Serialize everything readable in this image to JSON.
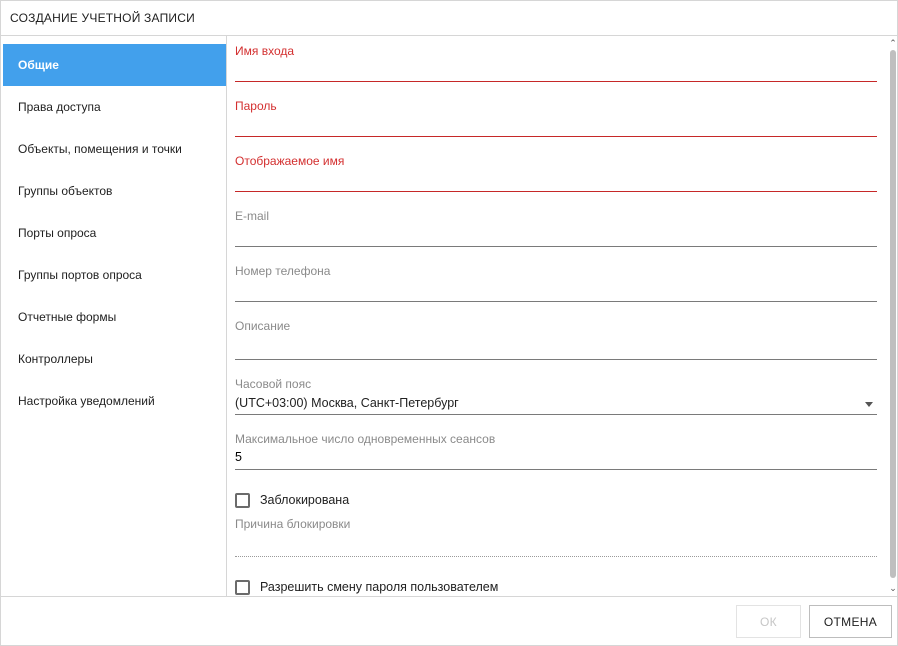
{
  "dialog": {
    "title": "СОЗДАНИЕ УЧЕТНОЙ ЗАПИСИ"
  },
  "sidebar": {
    "active_index": 0,
    "items": [
      {
        "label": "Общие"
      },
      {
        "label": "Права доступа"
      },
      {
        "label": "Объекты, помещения и точки"
      },
      {
        "label": "Группы объектов"
      },
      {
        "label": "Порты опроса"
      },
      {
        "label": "Группы портов опроса"
      },
      {
        "label": "Отчетные формы"
      },
      {
        "label": "Контроллеры"
      },
      {
        "label": "Настройка уведомлений"
      }
    ]
  },
  "form": {
    "login": {
      "label": "Имя входа",
      "value": "",
      "required": true
    },
    "password": {
      "label": "Пароль",
      "value": "",
      "required": true
    },
    "display_name": {
      "label": "Отображаемое имя",
      "value": "",
      "required": true
    },
    "email": {
      "label": "E-mail",
      "value": ""
    },
    "phone": {
      "label": "Номер телефона",
      "value": ""
    },
    "description": {
      "label": "Описание",
      "value": ""
    },
    "timezone": {
      "label": "Часовой пояс",
      "value": "(UTC+03:00) Москва, Санкт-Петербург"
    },
    "max_sessions": {
      "label": "Максимальное число одновременных сеансов",
      "value": "5"
    },
    "blocked": {
      "label": "Заблокирована",
      "checked": false
    },
    "block_reason": {
      "label": "Причина блокировки",
      "value": ""
    },
    "allow_password_change": {
      "label": "Разрешить смену пароля пользователем",
      "checked": false
    }
  },
  "footer": {
    "ok_label": "ОК",
    "ok_enabled": false,
    "cancel_label": "ОТМЕНА"
  },
  "colors": {
    "accent": "#42a0ec",
    "required": "#d32f2f",
    "border": "#d6d6d6"
  }
}
